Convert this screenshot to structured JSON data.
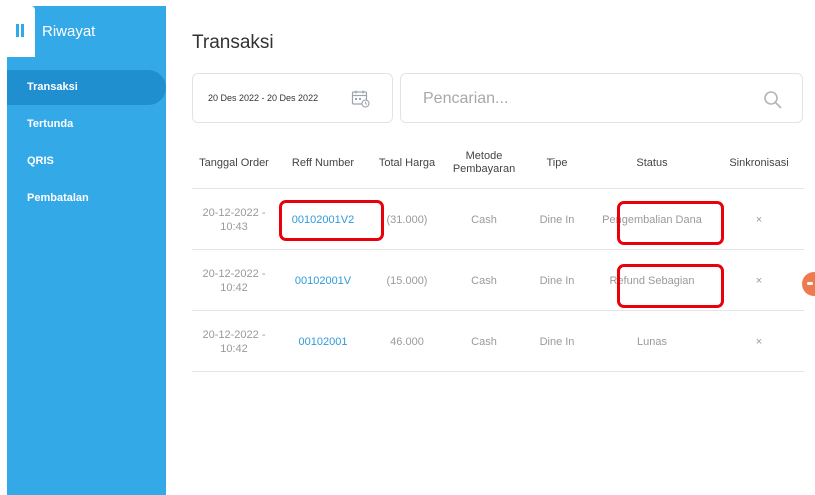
{
  "sidebar": {
    "title": "Riwayat",
    "items": [
      {
        "label": "Transaksi",
        "active": true
      },
      {
        "label": "Tertunda",
        "active": false
      },
      {
        "label": "QRIS",
        "active": false
      },
      {
        "label": "Pembatalan",
        "active": false
      }
    ]
  },
  "main": {
    "title": "Transaksi",
    "date_range": "20 Des 2022 - 20 Des 2022",
    "search_placeholder": "Pencarian...",
    "columns": [
      "Tanggal Order",
      "Reff Number",
      "Total Harga",
      "Metode Pembayaran",
      "Tipe",
      "Status",
      "Sinkronisasi"
    ],
    "rows": [
      {
        "date": "20-12-2022 - 10:43",
        "reff": "00102001V2",
        "total": "(31.000)",
        "method": "Cash",
        "type": "Dine In",
        "status": "Pengembalian Dana",
        "sync": "×"
      },
      {
        "date": "20-12-2022 - 10:42",
        "reff": "00102001V",
        "total": "(15.000)",
        "method": "Cash",
        "type": "Dine In",
        "status": "Refund Sebagian",
        "sync": "×"
      },
      {
        "date": "20-12-2022 - 10:42",
        "reff": "00102001",
        "total": "46.000",
        "method": "Cash",
        "type": "Dine In",
        "status": "Lunas",
        "sync": "×"
      }
    ]
  },
  "colors": {
    "sidebar_bg": "#33a9e8",
    "sidebar_active": "#1f8fcf",
    "link": "#2f9ad8",
    "highlight": "#e8000b",
    "accent_dot": "#f07a50"
  }
}
